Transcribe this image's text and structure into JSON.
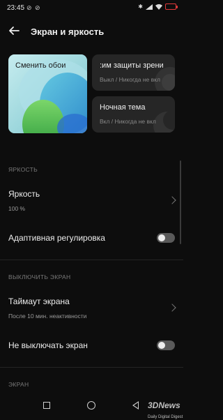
{
  "status_bar": {
    "time": "23:45",
    "left_icons": "⊘ ⊘",
    "battery": ""
  },
  "header": {
    "title": "Экран и яркость"
  },
  "cards": {
    "wallpaper": {
      "label": "Сменить обои"
    },
    "eye_protection": {
      "title": ":им защиты зрени",
      "sub": "Выкл / Никогда не вкл"
    },
    "dark_theme": {
      "title": "Ночная тема",
      "sub": "Вкл / Никогда не вкл"
    }
  },
  "sections": {
    "brightness": "ЯРКОСТЬ",
    "screen_off": "ВЫКЛЮЧИТЬ ЭКРАН",
    "screen": "ЭКРАН"
  },
  "rows": {
    "brightness": {
      "title": "Яркость",
      "sub": "100 %"
    },
    "adaptive": {
      "title": "Адаптивная регулировка",
      "checked": false
    },
    "timeout": {
      "title": "Таймаут экрана",
      "sub": "После 10 мин. неактивности"
    },
    "keep_on": {
      "title": "Не выключать экран",
      "checked": false
    }
  },
  "watermark": {
    "brand": "3DNews",
    "tagline": "Daily Digital Digest"
  },
  "colors": {
    "background": "#0d0d0d",
    "card": "#262626",
    "battery": "#e23a3a"
  }
}
